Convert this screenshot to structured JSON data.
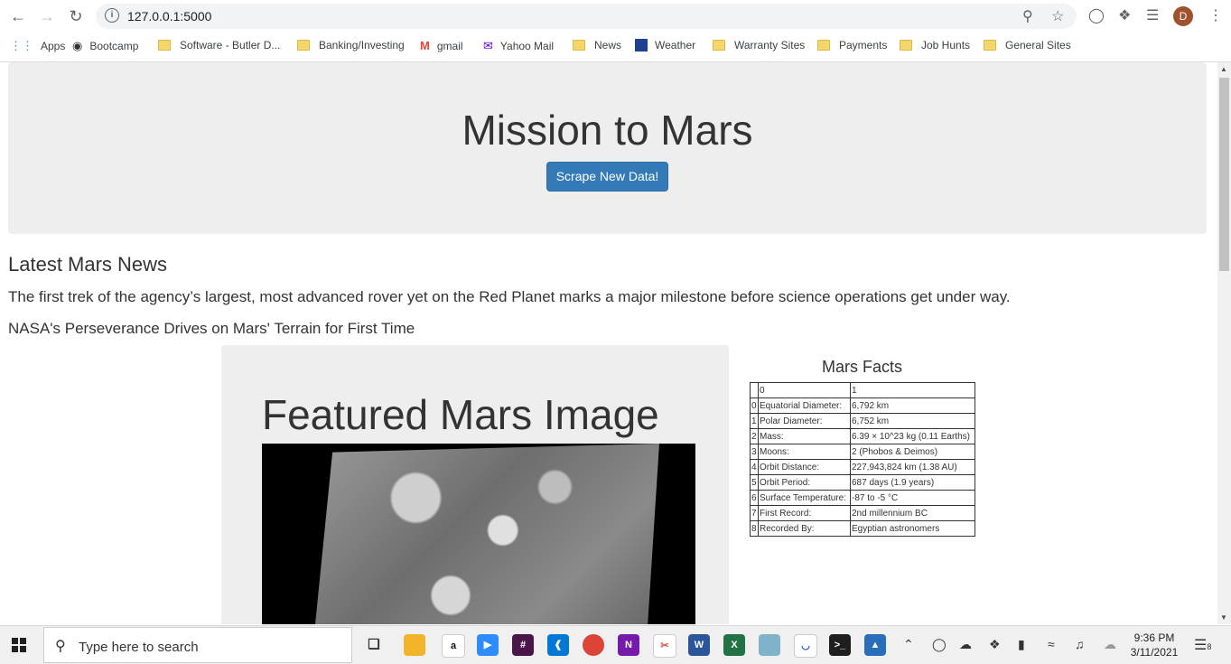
{
  "browser": {
    "url": "127.0.0.1:5000",
    "profile_initial": "D",
    "bookmarks": [
      {
        "label": "Apps",
        "icon": "apps-grid-icon"
      },
      {
        "label": "Bootcamp",
        "icon": "globe-icon"
      },
      {
        "label": "Software - Butler D...",
        "icon": "folder-icon"
      },
      {
        "label": "Banking/Investing",
        "icon": "folder-icon"
      },
      {
        "label": "gmail",
        "icon": "gmail-icon"
      },
      {
        "label": "Yahoo Mail",
        "icon": "yahoo-mail-icon"
      },
      {
        "label": "News",
        "icon": "folder-icon"
      },
      {
        "label": "Weather",
        "icon": "weather-channel-icon"
      },
      {
        "label": "Warranty Sites",
        "icon": "folder-icon"
      },
      {
        "label": "Payments",
        "icon": "folder-icon"
      },
      {
        "label": "Job Hunts",
        "icon": "folder-icon"
      },
      {
        "label": "General Sites",
        "icon": "folder-icon"
      }
    ]
  },
  "page": {
    "title": "Mission to Mars",
    "scrape_button": "Scrape New Data!",
    "news_heading": "Latest Mars News",
    "news_paragraph": "The first trek of the agency’s largest, most advanced rover yet on the Red Planet marks a major milestone before science operations get under way.",
    "news_title": "NASA's Perseverance Drives on Mars' Terrain for First Time",
    "featured_heading": "Featured Mars Image",
    "facts": {
      "title": "Mars Facts",
      "header": [
        "",
        "0",
        "1"
      ],
      "rows": [
        [
          "0",
          "Equatorial Diameter:",
          "6,792 km"
        ],
        [
          "1",
          "Polar Diameter:",
          "6,752 km"
        ],
        [
          "2",
          "Mass:",
          "6.39 × 10^23 kg (0.11 Earths)"
        ],
        [
          "3",
          "Moons:",
          "2 (Phobos & Deimos)"
        ],
        [
          "4",
          "Orbit Distance:",
          "227,943,824 km (1.38 AU)"
        ],
        [
          "5",
          "Orbit Period:",
          "687 days (1.9 years)"
        ],
        [
          "6",
          "Surface Temperature:",
          "-87 to -5 °C"
        ],
        [
          "7",
          "First Record:",
          "2nd millennium BC"
        ],
        [
          "8",
          "Recorded By:",
          "Egyptian astronomers"
        ]
      ]
    }
  },
  "taskbar": {
    "search_placeholder": "Type here to search",
    "time": "9:36 PM",
    "date": "3/11/2021",
    "notification_count": "8"
  },
  "colors": {
    "primary_button": "#337ab7",
    "jumbotron_bg": "#eeeeee"
  }
}
